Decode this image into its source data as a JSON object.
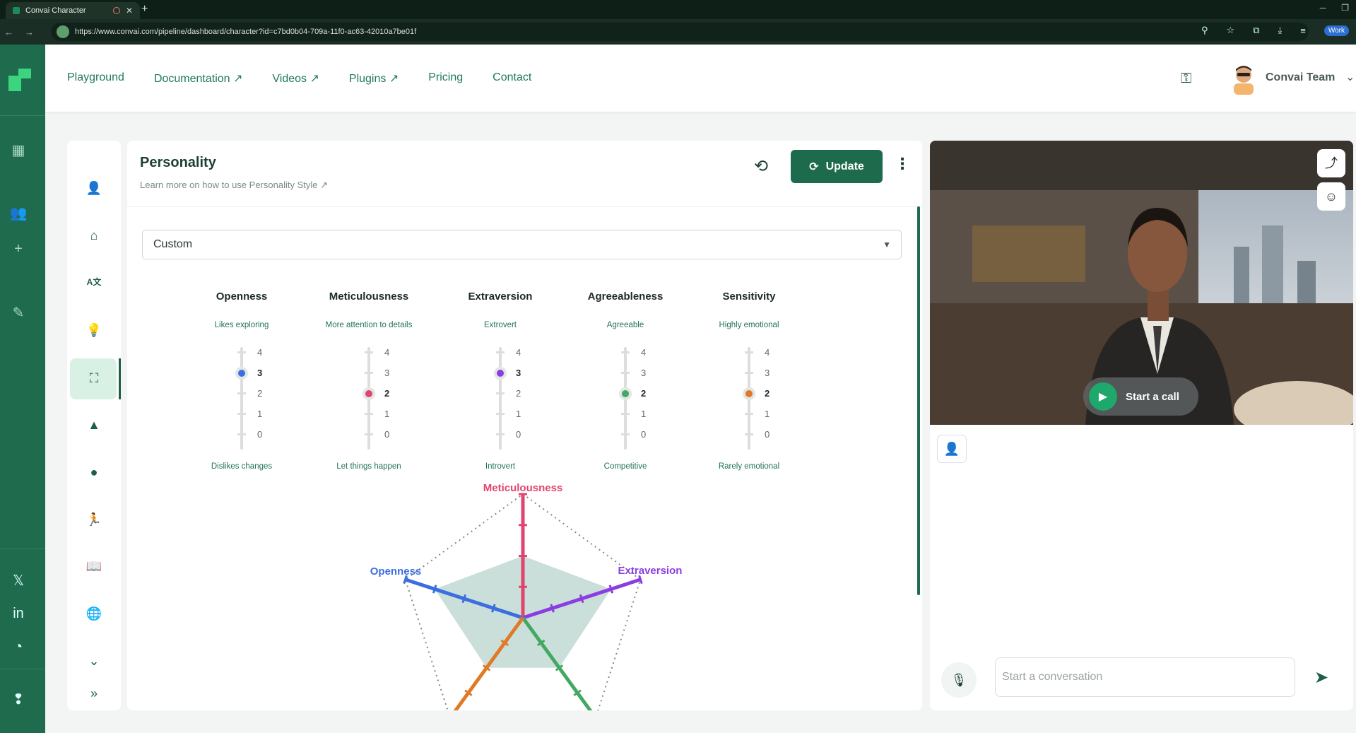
{
  "browser": {
    "tab_title": "Convai Character",
    "url": "https://www.convai.com/pipeline/dashboard/character?id=c7bd0b04-709a-11f0-ac63-42010a7be01f",
    "work_label": "Work"
  },
  "header": {
    "nav": [
      {
        "label": "Playground"
      },
      {
        "label": "Documentation ↗"
      },
      {
        "label": "Videos ↗"
      },
      {
        "label": "Plugins ↗"
      },
      {
        "label": "Pricing"
      },
      {
        "label": "Contact"
      }
    ],
    "user_name": "Convai Team"
  },
  "panel": {
    "title": "Personality",
    "subtitle": "Learn more on how to use Personality Style ↗",
    "update_label": "Update",
    "preset_value": "Custom"
  },
  "scale_ticks": [
    "4",
    "3",
    "2",
    "1",
    "0"
  ],
  "traits": [
    {
      "name": "Openness",
      "high": "Likes exploring",
      "low": "Dislikes changes",
      "value": 3,
      "color": "#3b6fe0"
    },
    {
      "name": "Meticulousness",
      "high": "More attention to details",
      "low": "Let things happen",
      "value": 2,
      "color": "#e0456f"
    },
    {
      "name": "Extraversion",
      "high": "Extrovert",
      "low": "Introvert",
      "value": 3,
      "color": "#8a3ee0"
    },
    {
      "name": "Agreeableness",
      "high": "Agreeable",
      "low": "Competitive",
      "value": 2,
      "color": "#43a861"
    },
    {
      "name": "Sensitivity",
      "high": "Highly emotional",
      "low": "Rarely emotional",
      "value": 2,
      "color": "#e07a26"
    }
  ],
  "radar": {
    "top_label": "Meticulousness",
    "left_label": "Openness",
    "right_label": "Extraversion"
  },
  "chat": {
    "call_label": "Start a call",
    "input_placeholder": "Start a conversation"
  },
  "colors": {
    "brand_dark": "#1d6b4c",
    "rail_bg": "#1e6b4d",
    "accent_text": "#20795a"
  }
}
